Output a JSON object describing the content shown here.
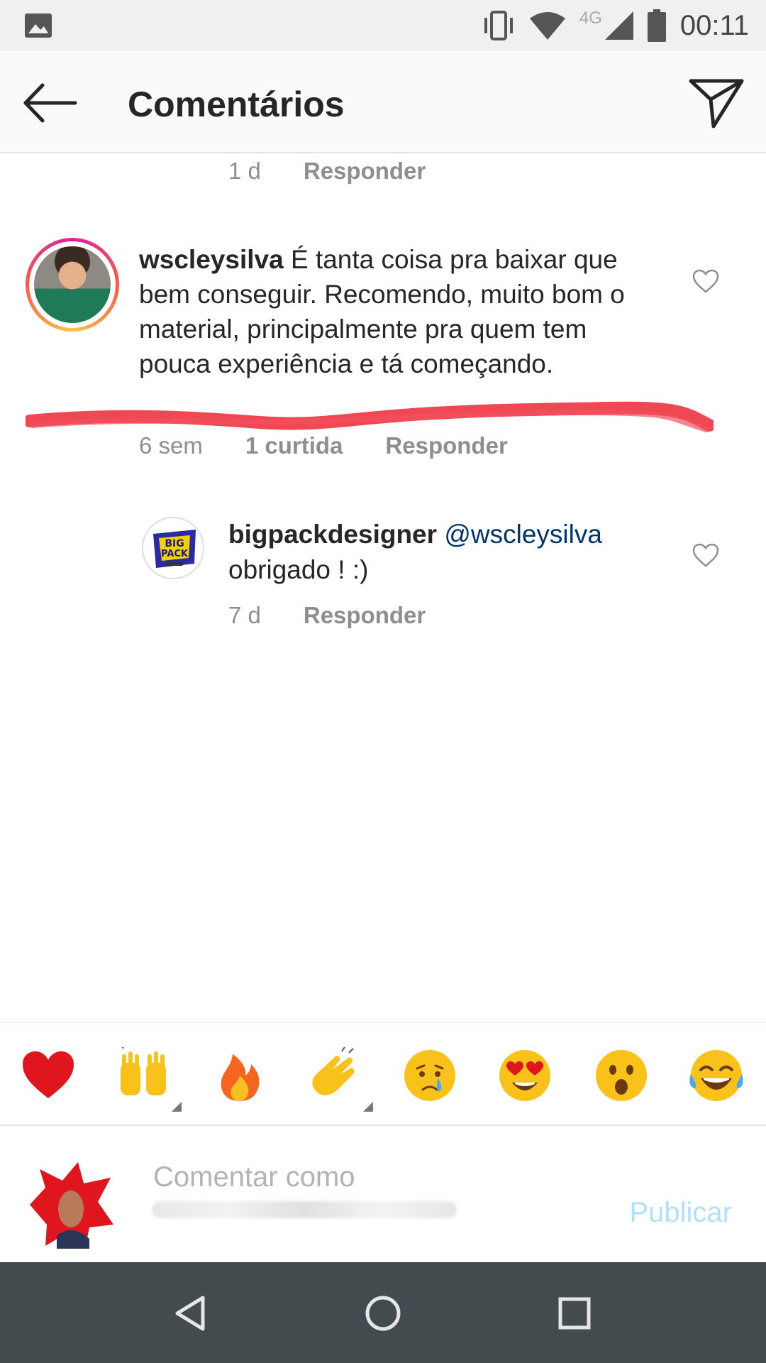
{
  "status_bar": {
    "network": "4G",
    "time": "00:11"
  },
  "header": {
    "title": "Comentários"
  },
  "prev_comment": {
    "time": "1 d",
    "reply_label": "Responder"
  },
  "comment": {
    "username": "wscleysilva",
    "text": "É tanta coisa pra baixar que bem conseguir. Recomendo, muito bom o material, principalmente pra quem tem pouca experiência e tá começando.",
    "time": "6 sem",
    "likes": "1 curtida",
    "reply_label": "Responder"
  },
  "reply": {
    "username": "bigpackdesigner",
    "mention": "@wscleysilva",
    "text": "obrigado ! :)",
    "time": "7 d",
    "reply_label": "Responder",
    "avatar_text": "BIG PACK"
  },
  "emoji_bar": [
    "heart",
    "raising-hands",
    "fire",
    "clapping-hands",
    "crying-face",
    "heart-eyes",
    "surprised-face",
    "tears-of-joy"
  ],
  "input": {
    "placeholder": "Comentar como",
    "publish_label": "Publicar"
  },
  "colors": {
    "mention": "#003569",
    "publish_disabled": "#b2dffc",
    "nav_bar": "#424b4e"
  }
}
